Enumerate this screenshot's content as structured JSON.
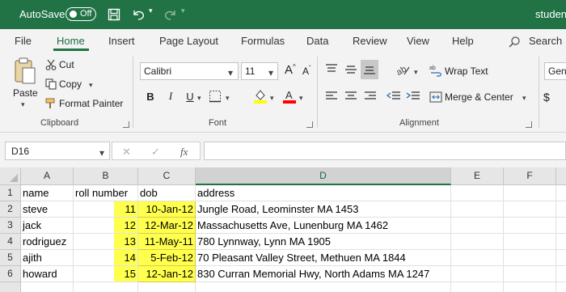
{
  "titlebar": {
    "autosave_label": "AutoSave",
    "autosave_state": "Off",
    "file_title": "studen"
  },
  "tabs": [
    "File",
    "Home",
    "Insert",
    "Page Layout",
    "Formulas",
    "Data",
    "Review",
    "View",
    "Help"
  ],
  "active_tab": "Home",
  "search_label": "Search",
  "clipboard": {
    "paste": "Paste",
    "cut": "Cut",
    "copy": "Copy",
    "format_painter": "Format Painter",
    "group_label": "Clipboard"
  },
  "font": {
    "name": "Calibri",
    "size": "11",
    "group_label": "Font",
    "bold": "B",
    "italic": "I",
    "underline": "U",
    "fill_color": "#ffff00",
    "font_color": "#ff0000"
  },
  "alignment": {
    "wrap_text": "Wrap Text",
    "merge_center": "Merge & Center",
    "group_label": "Alignment"
  },
  "number": {
    "format": "Gene",
    "currency_symbol": "$"
  },
  "formula_bar": {
    "name_box": "D16",
    "cancel": "✕",
    "enter": "✓",
    "fx": "fx",
    "value": ""
  },
  "sheet": {
    "columns": [
      "A",
      "B",
      "C",
      "D",
      "E",
      "F"
    ],
    "selected_column": "D",
    "rows": [
      {
        "num": "1",
        "A": "name",
        "B": "roll number",
        "C": "dob",
        "D": "address"
      },
      {
        "num": "2",
        "A": "steve",
        "B": "11",
        "C": "10-Jan-12",
        "D": "Jungle Road, Leominster MA 1453"
      },
      {
        "num": "3",
        "A": "jack",
        "B": "12",
        "C": "12-Mar-12",
        "D": "Massachusetts Ave, Lunenburg MA 1462"
      },
      {
        "num": "4",
        "A": "rodriguez",
        "B": "13",
        "C": "11-May-11",
        "D": "780 Lynnway, Lynn MA 1905"
      },
      {
        "num": "5",
        "A": "ajith",
        "B": "14",
        "C": "5-Feb-12",
        "D": "70 Pleasant Valley Street, Methuen MA 1844"
      },
      {
        "num": "6",
        "A": "howard",
        "B": "15",
        "C": "12-Jan-12",
        "D": "830 Curran Memorial Hwy, North Adams MA 1247"
      }
    ],
    "highlight_color": "#ffff4d"
  },
  "colors": {
    "excel_green": "#217346",
    "ribbon_bg": "#f3f3f3"
  }
}
